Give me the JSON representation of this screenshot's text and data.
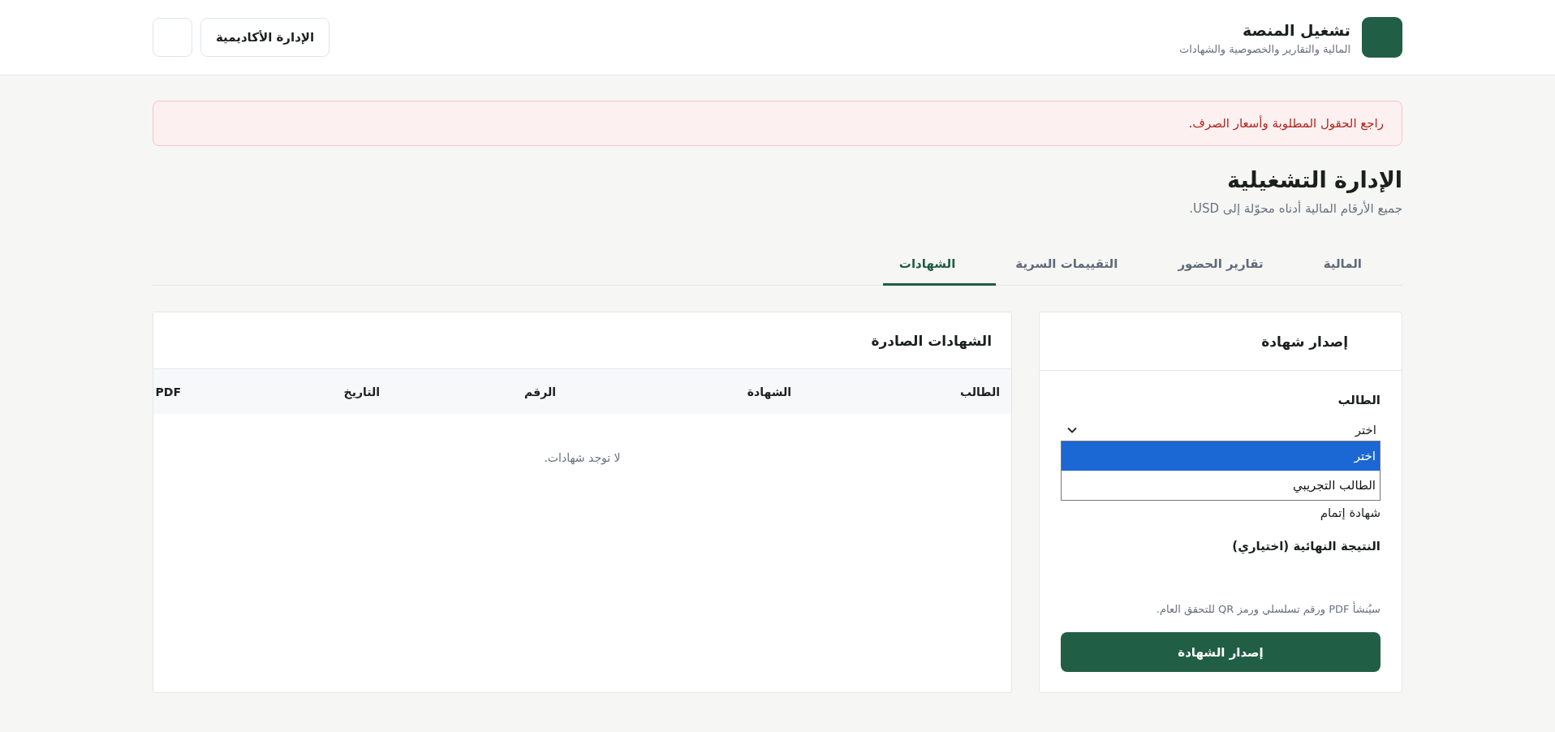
{
  "header": {
    "title": "تشغيل المنصة",
    "subtitle": "المالية والتقارير والخصوصية والشهادات",
    "buttons": [
      {
        "kind": "text",
        "label": "الإدارة الأكاديمية"
      },
      {
        "kind": "blank"
      }
    ]
  },
  "alert": {
    "text": "راجع الحقول المطلوبة وأسعار الصرف."
  },
  "page": {
    "title": "الإدارة التشغيلية",
    "subtitle": "جميع الأرقام المالية أدناه محوّلة إلى USD."
  },
  "tabs": [
    {
      "label": "المالية",
      "selected": false
    },
    {
      "label": "تقارير الحضور",
      "selected": false
    },
    {
      "label": "التقييمات السرية",
      "selected": false
    },
    {
      "label": "الشهادات",
      "selected": true
    }
  ],
  "issue_form": {
    "title": "إصدار شهادة",
    "fields": [
      {
        "kind": "select",
        "label": "الطالب",
        "value": "اختر",
        "expanded": true,
        "options": [
          {
            "label": "اختر",
            "selected": true
          },
          {
            "label": "الطالب التجريبي",
            "selected": false
          }
        ]
      },
      {
        "kind": "value",
        "value": "شهادة إتمام"
      },
      {
        "kind": "input",
        "label": "النتيجة النهائية (اختياري)"
      }
    ],
    "hint": "سيُنشأ PDF ورقم تسلسلي ورمز QR للتحقق العام.",
    "submit": "إصدار الشهادة"
  },
  "issued_table": {
    "title": "الشهادات الصادرة",
    "columns": [
      "الطالب",
      "الشهادة",
      "الرقم",
      "التاريخ",
      "PDF"
    ],
    "empty_message": "لا توجد شهادات."
  }
}
